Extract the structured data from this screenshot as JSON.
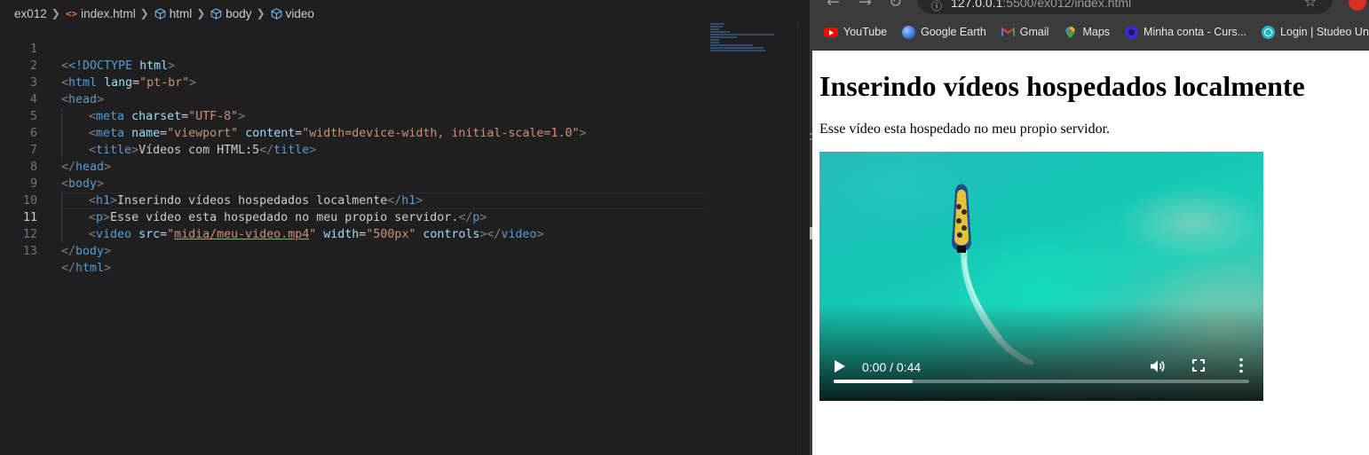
{
  "editor": {
    "breadcrumb": [
      "ex012",
      "index.html",
      "html",
      "body",
      "video"
    ],
    "lines": [
      {
        "n": "1"
      },
      {
        "n": "2"
      },
      {
        "n": "3"
      },
      {
        "n": "4"
      },
      {
        "n": "5"
      },
      {
        "n": "6"
      },
      {
        "n": "7"
      },
      {
        "n": "8"
      },
      {
        "n": "9"
      },
      {
        "n": "10"
      },
      {
        "n": "11"
      },
      {
        "n": "12"
      },
      {
        "n": "13"
      }
    ],
    "code": {
      "doctype": "<!DOCTYPE",
      "doctype_kw": "html",
      "html_tag": "html",
      "lang_attr": "lang",
      "lang_val": "\"pt-br\"",
      "head_tag": "head",
      "meta_tag": "meta",
      "charset_attr": "charset",
      "charset_val": "\"UTF-8\"",
      "name_attr": "name",
      "name_val": "\"viewport\"",
      "content_attr": "content",
      "content_val": "\"width=device-width, initial-scale=1.0\"",
      "title_tag": "title",
      "title_text": "Vídeos com HTML:5",
      "body_tag": "body",
      "h1_tag": "h1",
      "h1_text": "Inserindo vídeos hospedados localmente",
      "p_tag": "p",
      "p_text": "Esse vídeo esta hospedado no meu propio servidor.",
      "video_tag": "video",
      "src_attr": "src",
      "src_q1": "\"",
      "src_val": "midia/meu-video.mp4",
      "src_q2": "\"",
      "width_attr": "width",
      "width_val": "\"500px\"",
      "controls_attr": "controls"
    }
  },
  "browser": {
    "url_host": "127.0.0.1",
    "url_rest": ":5500/ex012/index.html",
    "bookmarks": [
      {
        "label": "YouTube"
      },
      {
        "label": "Google Earth"
      },
      {
        "label": "Gmail"
      },
      {
        "label": "Maps"
      },
      {
        "label": "Minha conta - Curs..."
      },
      {
        "label": "Login | Studeo Uni"
      }
    ],
    "page": {
      "heading": "Inserindo vídeos hospedados localmente",
      "paragraph": "Esse vídeo esta hospedado no meu propio servidor."
    },
    "video": {
      "time": "0:00 / 0:44",
      "progress_fraction": 0.19
    }
  }
}
